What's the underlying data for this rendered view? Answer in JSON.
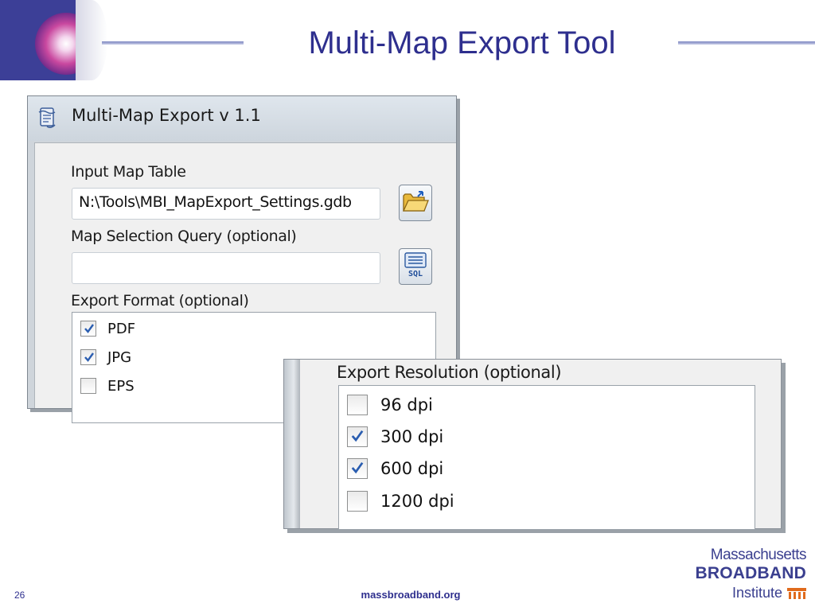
{
  "slide": {
    "title": "Multi-Map Export Tool",
    "page_number": "26",
    "footer_url": "massbroadband.org",
    "brand": {
      "line1": "Massachusetts",
      "line2": "BROADBAND",
      "line3": "Institute"
    }
  },
  "dialog": {
    "title": "Multi-Map Export v 1.1",
    "input_map_table": {
      "label": "Input Map Table",
      "value": "N:\\Tools\\MBI_MapExport_Settings.gdb"
    },
    "map_selection_query": {
      "label": "Map Selection Query (optional)",
      "value": ""
    },
    "export_format": {
      "label": "Export Format (optional)",
      "options": [
        {
          "label": "PDF",
          "checked": true
        },
        {
          "label": "JPG",
          "checked": true
        },
        {
          "label": "EPS",
          "checked": false
        }
      ]
    }
  },
  "resolution_panel": {
    "label": "Export Resolution (optional)",
    "options": [
      {
        "label": "96 dpi",
        "checked": false
      },
      {
        "label": "300 dpi",
        "checked": true
      },
      {
        "label": "600 dpi",
        "checked": true
      },
      {
        "label": "1200 dpi",
        "checked": false
      }
    ]
  },
  "icons": {
    "browse": "open-folder-icon",
    "sql": "sql-query-icon",
    "app": "script-tool-icon"
  },
  "colors": {
    "title_blue": "#2e2f8e",
    "check_blue": "#2a5db0"
  }
}
